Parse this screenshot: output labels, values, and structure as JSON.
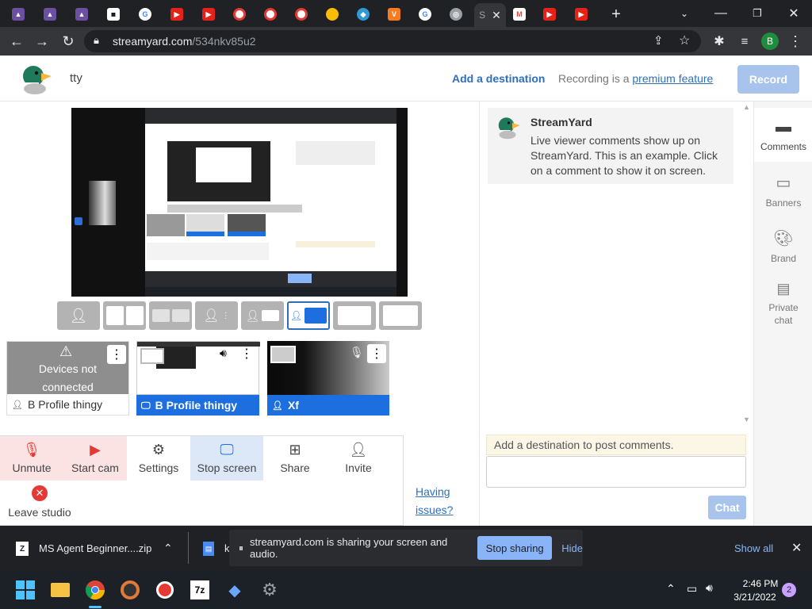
{
  "browser": {
    "url_host": "streamyard.com",
    "url_path": "/534nkv85u2",
    "active_tab_letter": "S",
    "profile_initial": "B"
  },
  "header": {
    "studio_name": "tty",
    "add_destination": "Add a destination",
    "recording_prefix": "Recording is a ",
    "recording_link": "premium feature",
    "record_label": "Record"
  },
  "tiles": [
    {
      "status_lines": [
        "Devices not",
        "connected"
      ],
      "label": "B Profile thingy"
    },
    {
      "label": "B Profile thingy"
    },
    {
      "label": "Xf"
    }
  ],
  "controls": {
    "unmute": "Unmute",
    "start_cam": "Start cam",
    "settings": "Settings",
    "stop_screen": "Stop screen",
    "share": "Share",
    "invite": "Invite",
    "leave_studio": "Leave studio",
    "having_issues_1": "Having",
    "having_issues_2": "issues?"
  },
  "comments": {
    "author": "StreamYard",
    "text": "Live viewer comments show up on StreamYard. This is an example. Click on a comment to show it on screen.",
    "add_destination_notice": "Add a destination to post comments.",
    "chat_label": "Chat"
  },
  "side_tabs": [
    {
      "label": "Comments"
    },
    {
      "label": "Banners"
    },
    {
      "label": "Brand"
    },
    {
      "label_1": "Private",
      "label_2": "chat"
    }
  ],
  "downloads": {
    "file1": "MS Agent Beginner....zip",
    "file2_fragment": "k",
    "share_message": "streamyard.com is sharing your screen and audio.",
    "stop_sharing": "Stop sharing",
    "hide": "Hide",
    "show_all": "Show all"
  },
  "taskbar": {
    "time": "2:46 PM",
    "date": "3/21/2022",
    "notifications": "2"
  },
  "colors": {
    "accent_blue": "#2e6fbd",
    "tile_label_blue": "#1d6fe0",
    "record_disabled": "#a8c4ec",
    "danger_red": "#e53935"
  }
}
